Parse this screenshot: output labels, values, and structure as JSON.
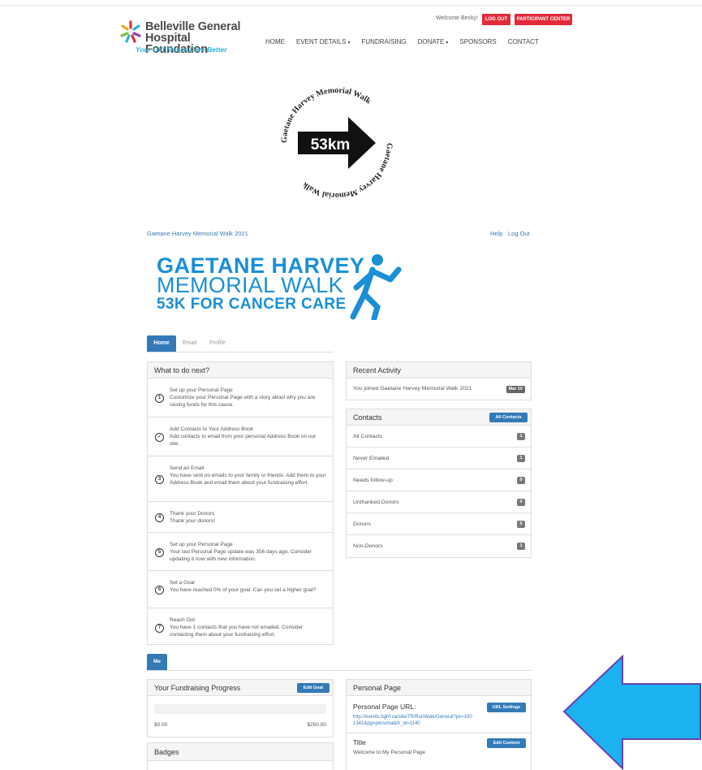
{
  "header": {
    "logo_line1": "Belleville General",
    "logo_line2": "Hospital Foundation",
    "tagline": "Your Gift Makes Care Better",
    "welcome": "Welcome Becky!",
    "logout_label": "LOG OUT",
    "participant_center_label": "PARTICIPANT CENTER",
    "nav": [
      "HOME",
      "EVENT DETAILS",
      "FUNDRAISING",
      "DONATE",
      "SPONSORS",
      "CONTACT"
    ]
  },
  "badge": {
    "ring_text": "Gaetane Harvey Memorial Walk",
    "distance": "53km"
  },
  "event": {
    "name": "Gaetane Harvey Memorial Walk 2021",
    "help": "Help",
    "logout": "Log Out"
  },
  "banner": {
    "line1": "GAETANE HARVEY",
    "line2": "MEMORIAL WALK",
    "line3": "53K FOR CANCER CARE"
  },
  "tabs": {
    "home": "Home",
    "email": "Email",
    "profile": "Profile"
  },
  "todo": {
    "title": "What to do next?",
    "items": [
      {
        "num": "1",
        "title": "Set up your Personal Page",
        "desc": "Customize your Personal Page with a story about why you are raising funds for this cause."
      },
      {
        "num": "✓",
        "title": "Add Contacts to Your Address Book",
        "desc": "Add contacts to email from your personal Address Book on our site."
      },
      {
        "num": "3",
        "title": "Send an Email",
        "desc": "You have sent no emails to your family or friends. Add them to your Address Book and email them about your fundraising effort."
      },
      {
        "num": "4",
        "title": "Thank your Donors",
        "desc": "Thank your donors!"
      },
      {
        "num": "5",
        "title": "Set up your Personal Page",
        "desc": "Your last Personal Page update was 356 days ago. Consider updating it now with new information."
      },
      {
        "num": "6",
        "title": "Set a Goal",
        "desc": "You have reached 0% of your goal. Can you set a higher goal?"
      },
      {
        "num": "7",
        "title": "Reach Out",
        "desc": "You have 1 contacts that you have not emailed. Consider contacting them about your fundraising effort."
      }
    ]
  },
  "activity": {
    "title": "Recent Activity",
    "text": "You joined Gaetane Harvey Memorial Walk 2021",
    "date": "Mar 10"
  },
  "contacts": {
    "title": "Contacts",
    "button": "All Contacts",
    "rows": [
      {
        "label": "All Contacts",
        "count": "1"
      },
      {
        "label": "Never Emailed",
        "count": "1"
      },
      {
        "label": "Needs follow-up",
        "count": "0"
      },
      {
        "label": "Unthanked Donors",
        "count": "0"
      },
      {
        "label": "Donors",
        "count": "0"
      },
      {
        "label": "Non-Donors",
        "count": "1"
      }
    ]
  },
  "me_tab": "Me",
  "progress": {
    "title": "Your Fundraising Progress",
    "button": "Edit Goal",
    "raised": "$0.00",
    "goal": "$250.00",
    "fraction": 0
  },
  "badges": {
    "title": "Badges"
  },
  "personal_page": {
    "title": "Personal Page",
    "url_label": "Personal Page URL:",
    "url_button": "URL Settings",
    "url": "http://events.bghf.ca/site/TR/RunWalk/General?px=1001341&pg=personal&fr_id=1140",
    "title_label": "Title",
    "title_button": "Edit Content",
    "title_value": "Welcome to My Personal Page"
  },
  "colors": {
    "brand_blue": "#337ab7",
    "logout_red": "#e32b3a",
    "banner_blue": "#1a8fd6",
    "arrow_fill": "#1bb2ef",
    "arrow_stroke": "#6a3fb5"
  }
}
